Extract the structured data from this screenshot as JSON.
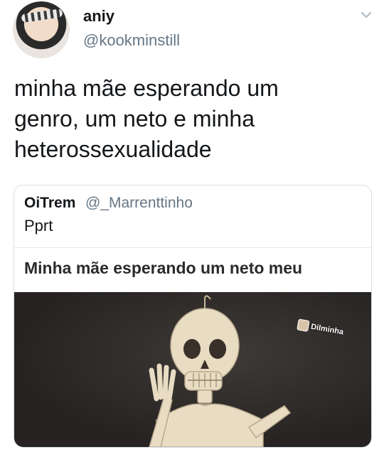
{
  "tweet": {
    "display_name": "aniy",
    "handle": "@kookminstill",
    "text": "minha mãe esperando um\ngenro, um neto e minha\nheterossexualidade"
  },
  "quoted_tweet": {
    "display_name": "OiTrem",
    "handle": "@_Marrenttinho",
    "text": "Pprt",
    "meme_caption": "Minha mãe esperando um neto meu",
    "watermark": "Dilminha"
  },
  "icons": {
    "more_menu": "chevron-down-icon"
  },
  "colors": {
    "primary_text": "#14171a",
    "secondary_text": "#657786",
    "border": "#d7dfe6"
  }
}
